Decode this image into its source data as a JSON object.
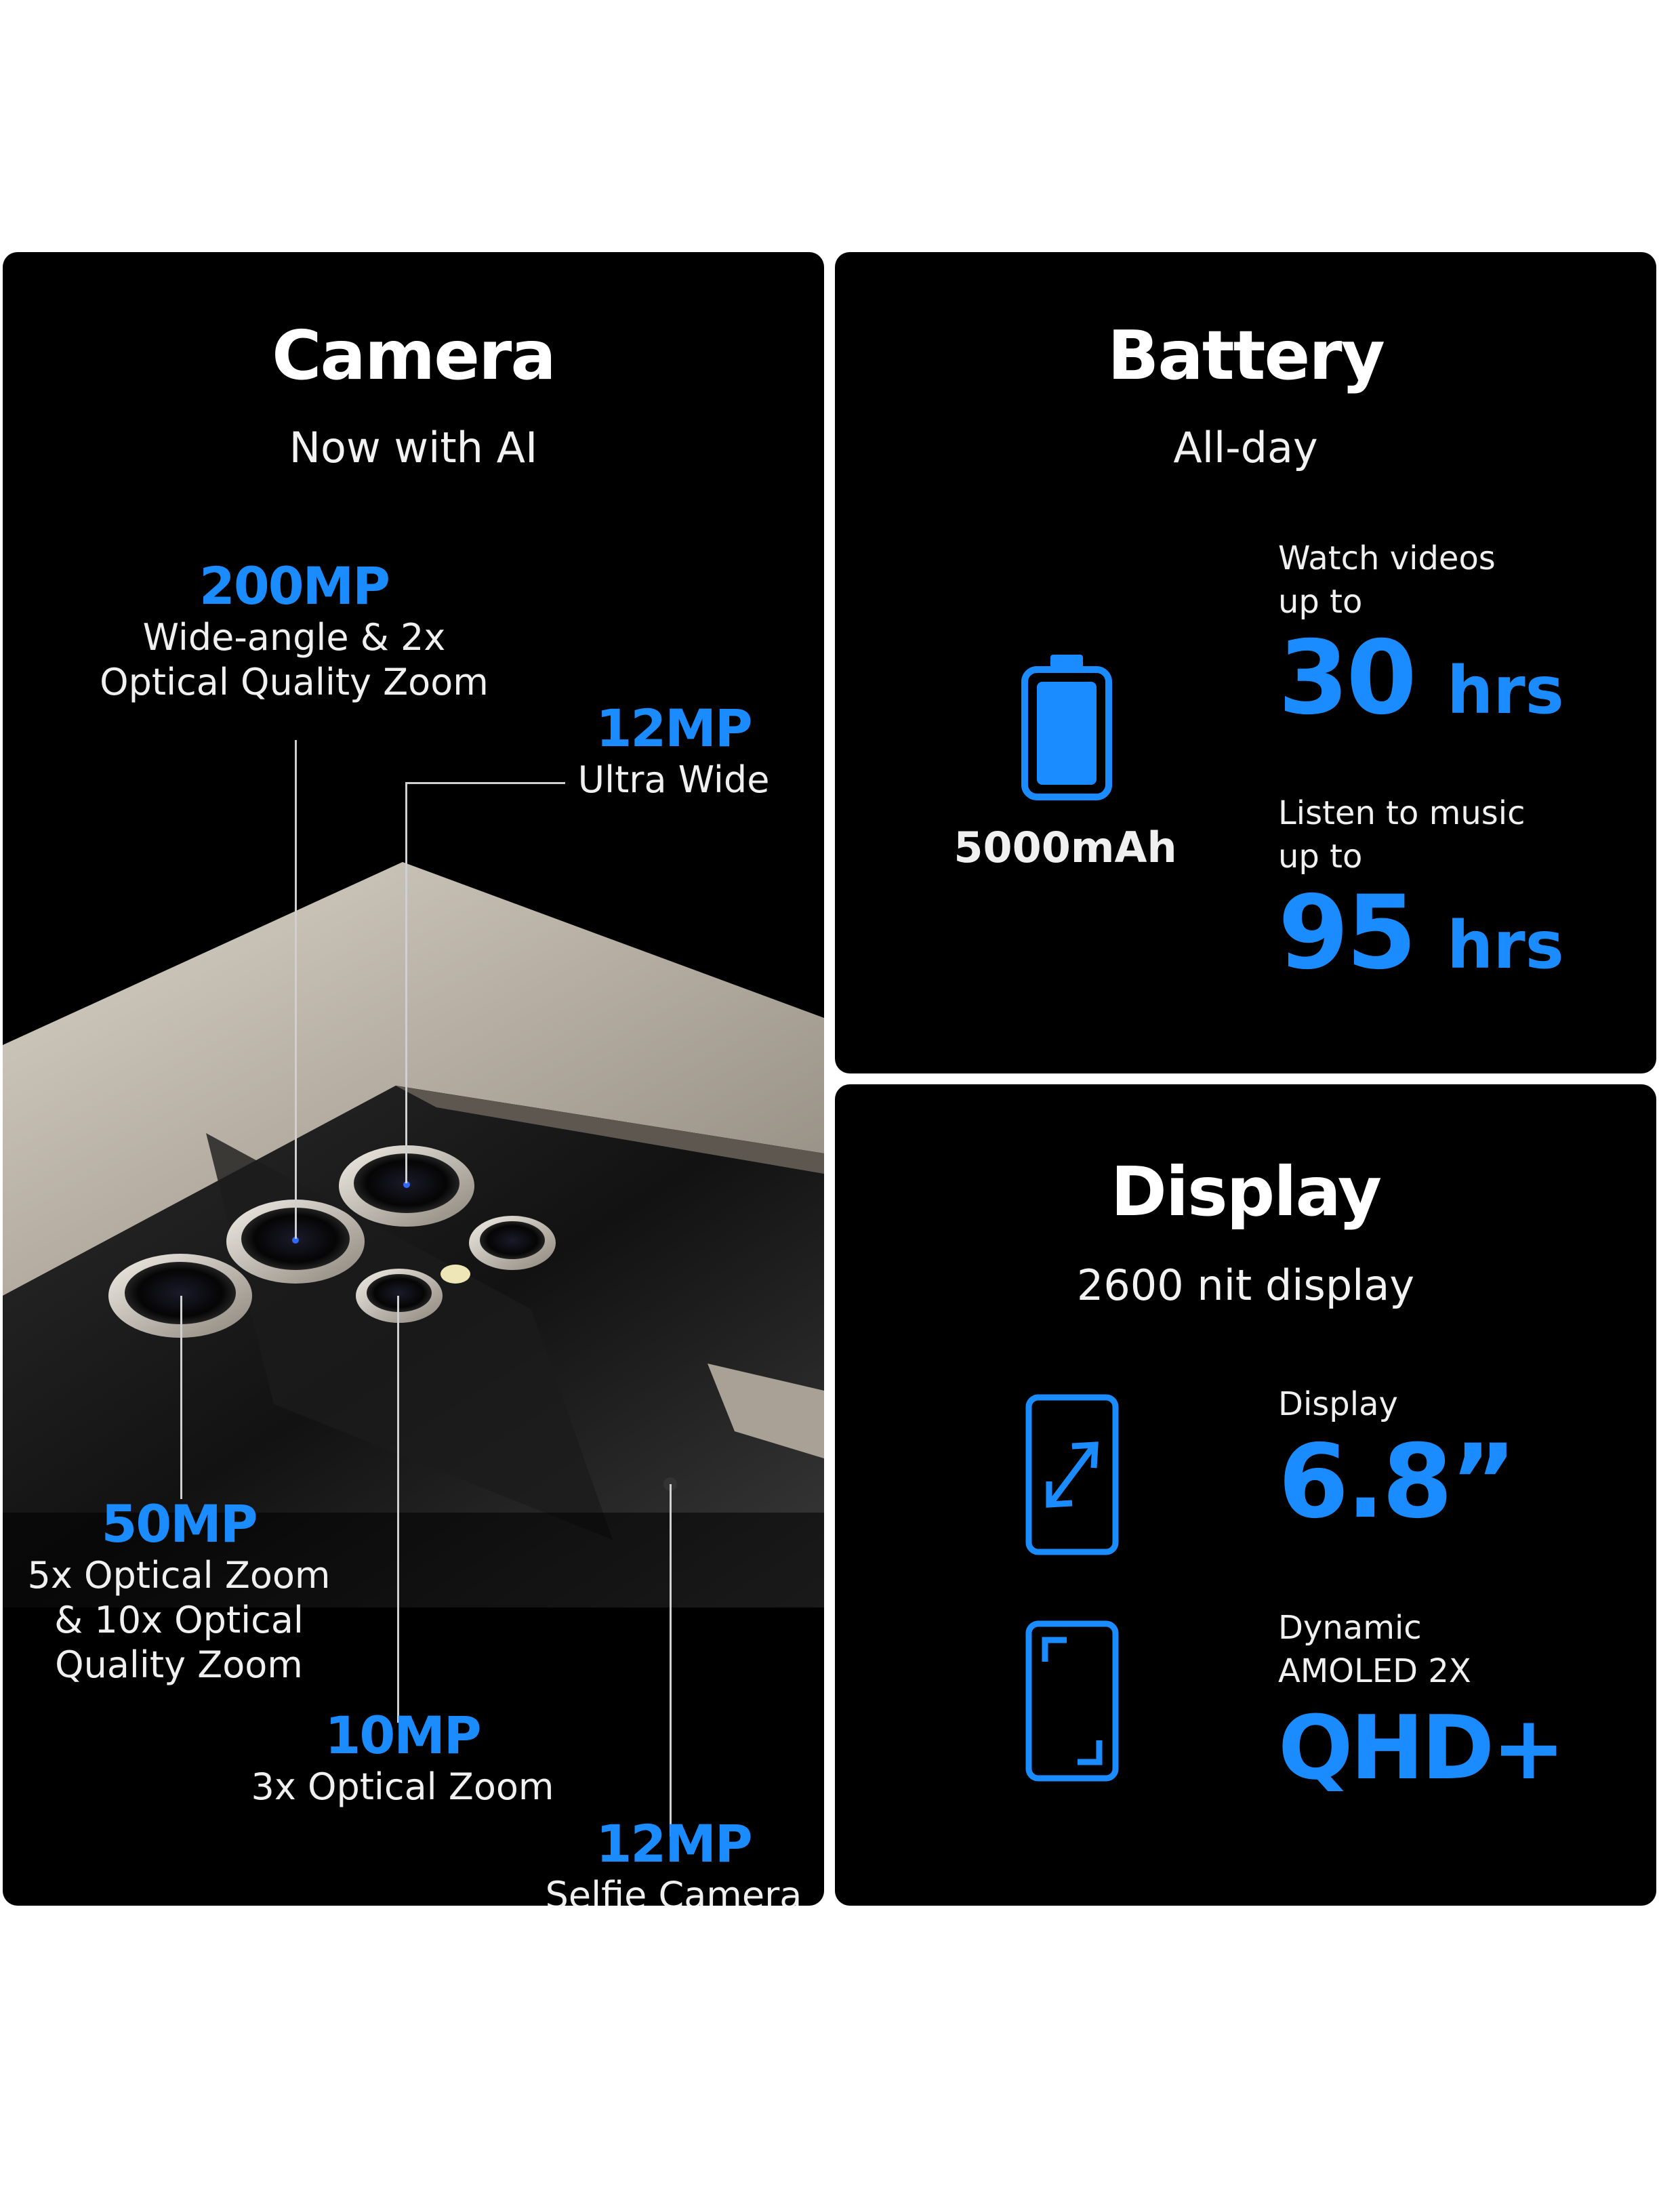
{
  "camera": {
    "title": "Camera",
    "subtitle": "Now with AI",
    "specs": [
      {
        "mp": "200MP",
        "desc": [
          "Wide-angle & 2x",
          "Optical Quality Zoom"
        ]
      },
      {
        "mp": "12MP",
        "desc": [
          "Ultra Wide"
        ]
      },
      {
        "mp": "50MP",
        "desc": [
          "5x Optical Zoom",
          "& 10x Optical",
          "Quality Zoom"
        ]
      },
      {
        "mp": "10MP",
        "desc": [
          "3x Optical Zoom"
        ]
      },
      {
        "mp": "12MP",
        "desc": [
          "Selfie Camera"
        ]
      }
    ]
  },
  "battery": {
    "title": "Battery",
    "subtitle": "All-day",
    "capacity": "5000mAh",
    "video": {
      "label": [
        "Watch videos",
        "up to"
      ],
      "value": "30",
      "unit": "hrs"
    },
    "music": {
      "label": [
        "Listen to music",
        "up to"
      ],
      "value": "95",
      "unit": "hrs"
    }
  },
  "display": {
    "title": "Display",
    "subtitle": "2600 nit display",
    "size": {
      "label": [
        "Display"
      ],
      "value": "6.8”"
    },
    "panel": {
      "label": [
        "Dynamic",
        "AMOLED 2X"
      ],
      "value": "QHD+"
    }
  },
  "colors": {
    "accent": "#1b8cff",
    "panel": "#000000",
    "phone_body": "#b9b1a6"
  }
}
